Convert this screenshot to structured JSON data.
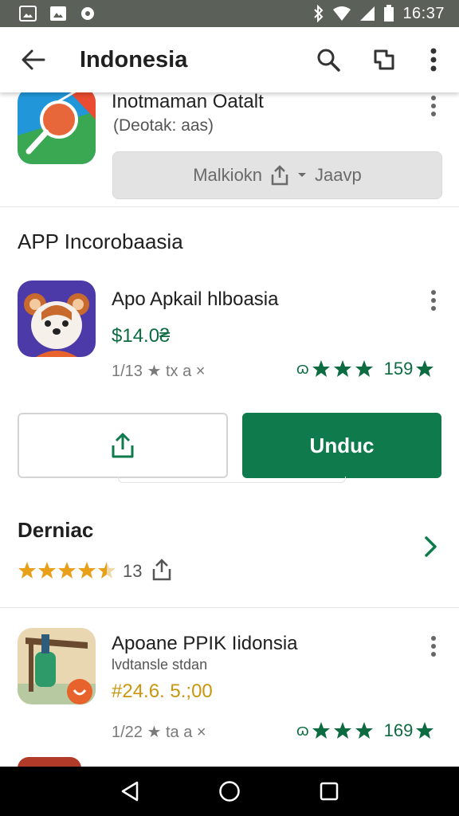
{
  "status_bar": {
    "time": "16:37"
  },
  "app_bar": {
    "title": "Indonesia"
  },
  "top_card": {
    "name": "Inotmaman Oatalt",
    "subtitle": "(Deotak: aas)",
    "button_label": "Malkiokn",
    "button_label_2": "Jaavp"
  },
  "section": {
    "title": "APP Incorobaasia"
  },
  "featured_app": {
    "name": "Apo Apkail hlboasia",
    "price": "$14.0₴",
    "meta": "1/13 ★ tx a ×",
    "rating_prefix": "ɷ",
    "rating_count": "159",
    "install_label": "Unduc"
  },
  "reviews": {
    "title": "Derniac",
    "rating_value": "4.5",
    "count": "13"
  },
  "second_app": {
    "name": "Apoane PPIK Iidonsia",
    "subtitle": "lvdtansle stdan",
    "price": "#24.6. 5.;00",
    "meta": "1/22 ★ ta a ×",
    "rating_prefix": "ɷ",
    "rating_count": "169"
  },
  "colors": {
    "accent_green": "#0f7a4b",
    "star_gold": "#e8a01a",
    "status_bar": "#5b6159"
  },
  "icons": {
    "back": "arrow-left-icon",
    "search": "search-icon",
    "share": "share-icon",
    "more": "more-vert-icon"
  }
}
